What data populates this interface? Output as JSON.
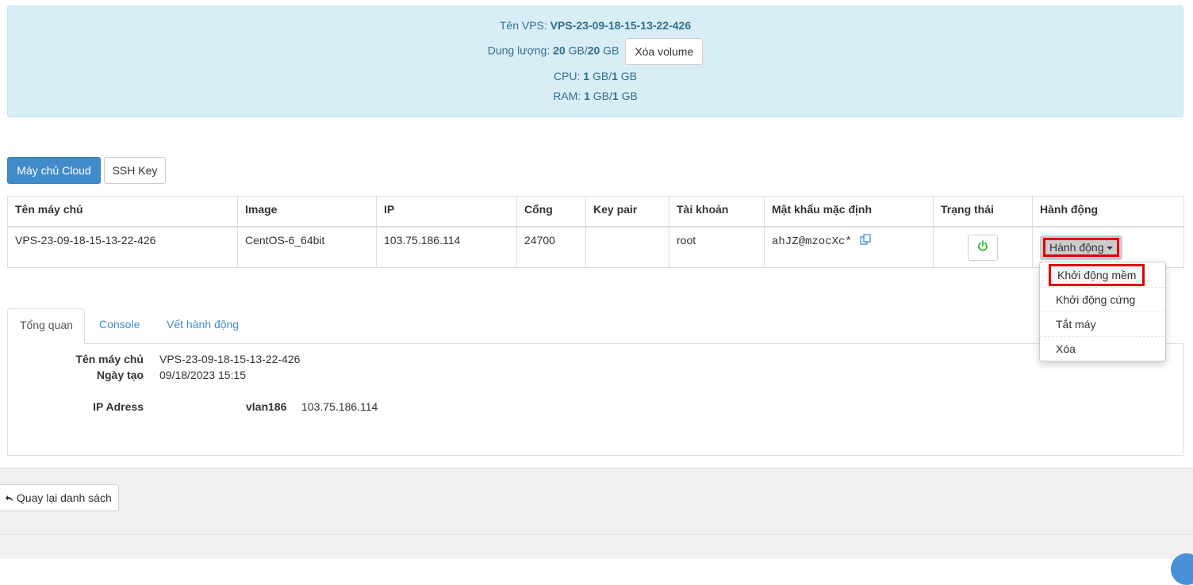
{
  "vps_info": {
    "name_label": "Tên VPS:",
    "name_value": "VPS-23-09-18-15-13-22-426",
    "storage_label": "Dung lượng:",
    "storage_used": "20",
    "storage_sep": " GB/",
    "storage_total": "20",
    "storage_unit": " GB",
    "delete_volume_label": "Xóa volume",
    "cpu_label": "CPU:",
    "cpu_used": "1",
    "cpu_sep": " GB/",
    "cpu_total": "1",
    "cpu_unit": " GB",
    "ram_label": "RAM:",
    "ram_used": "1",
    "ram_sep": " GB/",
    "ram_total": "1",
    "ram_unit": " GB"
  },
  "nav": {
    "cloud_label": "Máy chủ Cloud",
    "ssh_label": "SSH Key"
  },
  "table": {
    "headers": [
      "Tên máy chủ",
      "Image",
      "IP",
      "Cổng",
      "Key pair",
      "Tài khoản",
      "Mật khẩu mặc định",
      "Trạng thái",
      "Hành động"
    ],
    "row": {
      "name": "VPS-23-09-18-15-13-22-426",
      "image": "CentOS-6_64bit",
      "ip": "103.75.186.114",
      "port": "24700",
      "key_pair": "",
      "account": "root",
      "password": "ahJZ@mzocXc*",
      "status_icon": "power-icon",
      "action_label": "Hành động"
    }
  },
  "action_menu": {
    "items": [
      "Khởi động mềm",
      "Khởi động cứng",
      "Tắt máy",
      "Xóa"
    ]
  },
  "tabs": {
    "items": [
      "Tổng quan",
      "Console",
      "Vết hành động"
    ]
  },
  "overview": {
    "hostname_label": "Tên máy chủ",
    "hostname_value": "VPS-23-09-18-15-13-22-426",
    "created_label": "Ngày tạo",
    "created_value": "09/18/2023 15:15",
    "ip_label": "IP Adress",
    "ip_network": "vlan186",
    "ip_value": "103.75.186.114"
  },
  "footer": {
    "back_label": "Quay lại danh sách"
  },
  "colors": {
    "info_bg": "#d9edf7",
    "info_text": "#31708f",
    "primary": "#428bca",
    "highlight": "#e00000",
    "power_green": "#2eb82e"
  }
}
